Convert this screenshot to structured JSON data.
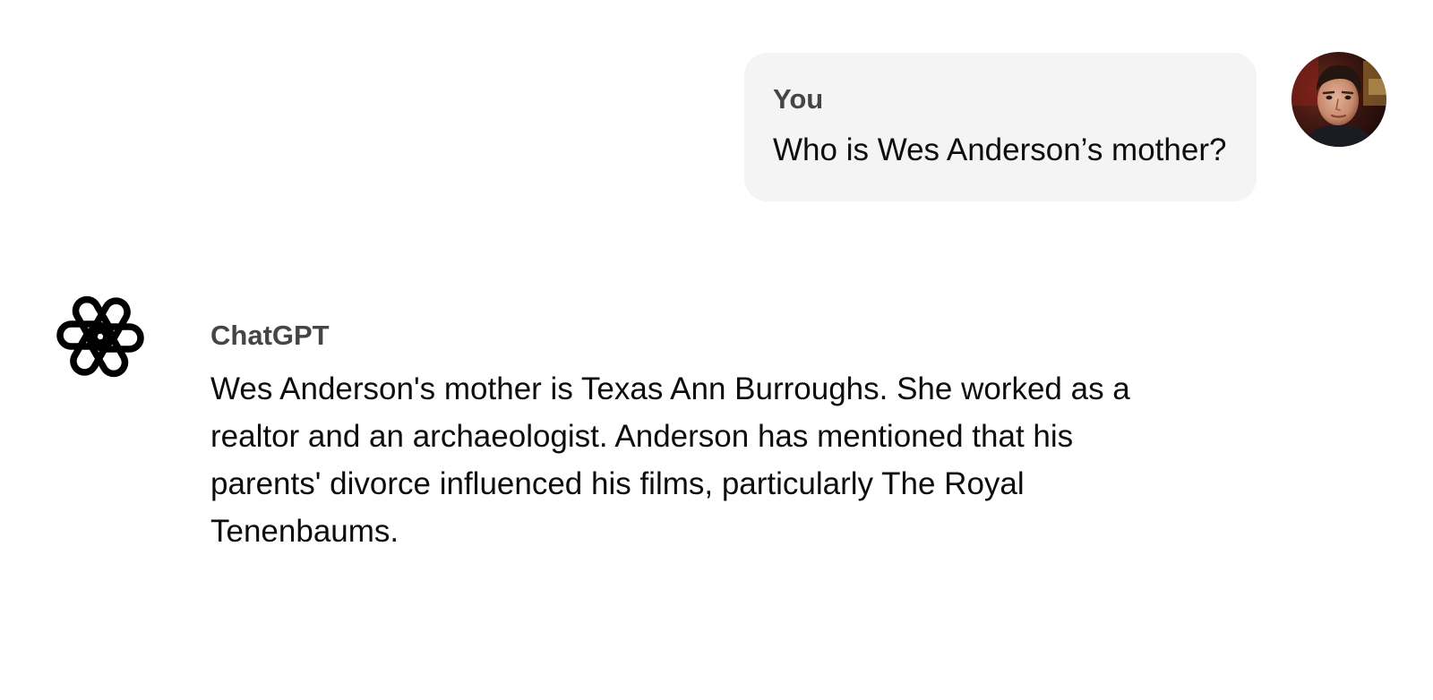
{
  "user": {
    "name": "You",
    "message": "Who is Wes Anderson’s mother?",
    "avatar_icon": "user-avatar-photo"
  },
  "assistant": {
    "name": "ChatGPT",
    "logo_icon": "openai-logo-icon",
    "message": "Wes Anderson's mother is Texas Ann Burroughs. She worked as a realtor and an archaeologist. Anderson has mentioned that his parents' divorce influenced his films, particularly The Royal Tenenbaums."
  },
  "colors": {
    "background": "#ffffff",
    "user_bubble": "#f4f4f4",
    "name_text": "#454545",
    "body_text": "#0d0d0d"
  }
}
